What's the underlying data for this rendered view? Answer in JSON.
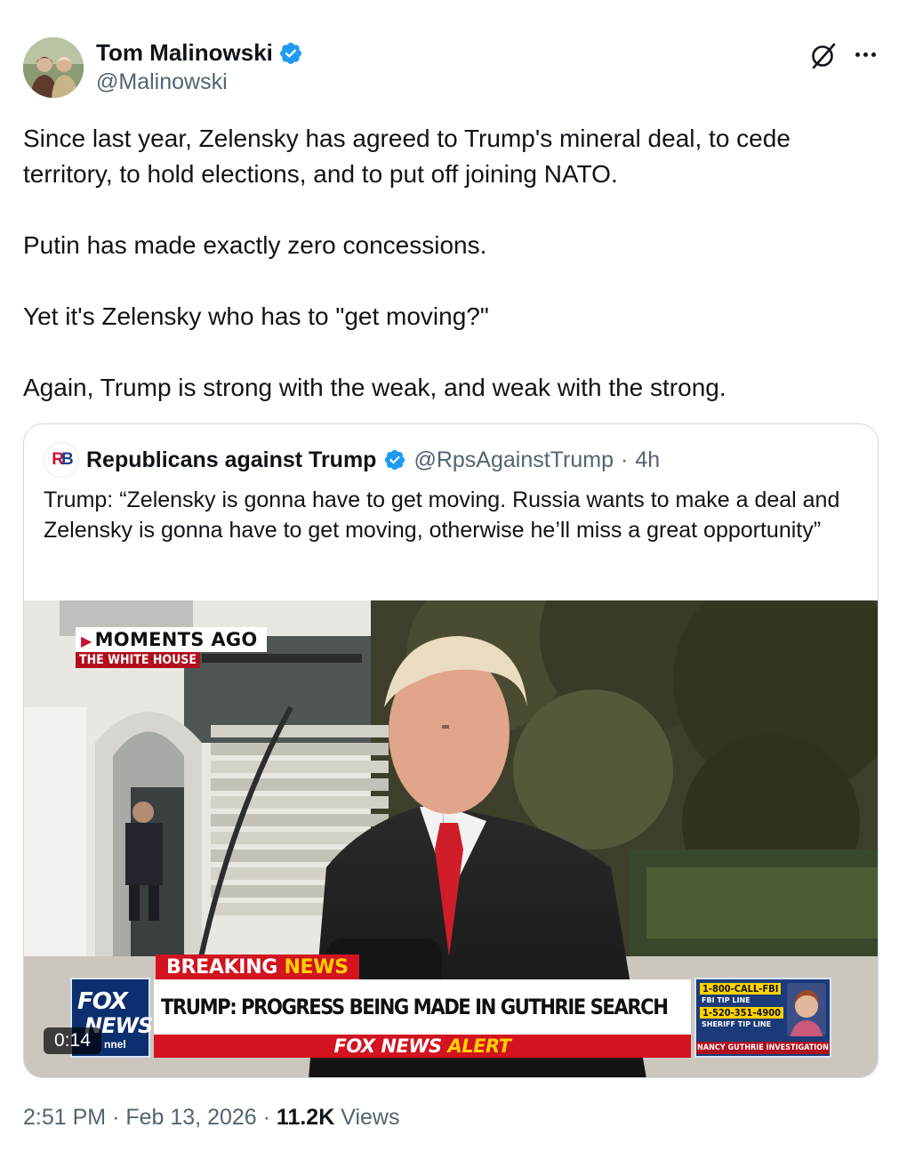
{
  "author": {
    "name": "Tom Malinowski",
    "handle": "@Malinowski"
  },
  "post": {
    "paragraphs": [
      "Since last year, Zelensky has agreed to Trump's mineral deal, to cede territory, to hold elections, and to put off joining NATO.",
      "Putin has made exactly zero concessions.",
      "Yet it's Zelensky who has to \"get moving?\"",
      "Again, Trump is strong with the weak, and weak with the strong."
    ]
  },
  "quoted": {
    "name": "Republicans against Trump",
    "handle": "@RpsAgainstTrump",
    "separator": "·",
    "age": "4h",
    "text": "Trump: “Zelensky is gonna have to get moving. Russia wants to make a deal and Zelensky is gonna have to get moving, otherwise he’ll miss a great opportunity”",
    "video": {
      "duration": "0:14",
      "overlay": {
        "moments": "MOMENTS AGO",
        "location": "THE WHITE HOUSE",
        "breaking_a": "BREAKING",
        "breaking_b": "NEWS",
        "headline": "TRUMP: PROGRESS BEING MADE IN GUTHRIE SEARCH",
        "alert_a": "FOX NEWS",
        "alert_b": "ALERT",
        "logo_a": "FOX",
        "logo_b": "NEWS",
        "logo_c": "nnel",
        "tip_line_1": "1-800-CALL-FBI",
        "tip_line_1_sub": "FBI TIP LINE",
        "tip_line_2": "1-520-351-4900",
        "tip_line_2_sub": "SHERIFF TIP LINE",
        "tip_caption": "NANCY GUTHRIE INVESTIGATION"
      }
    }
  },
  "meta": {
    "time": "2:51 PM",
    "sep": "·",
    "date": "Feb 13, 2026",
    "views_count": "11.2K",
    "views_label": "Views"
  },
  "colors": {
    "verified": "#1d9bf0",
    "secondary_text": "#536471",
    "border": "#cfd9de"
  }
}
